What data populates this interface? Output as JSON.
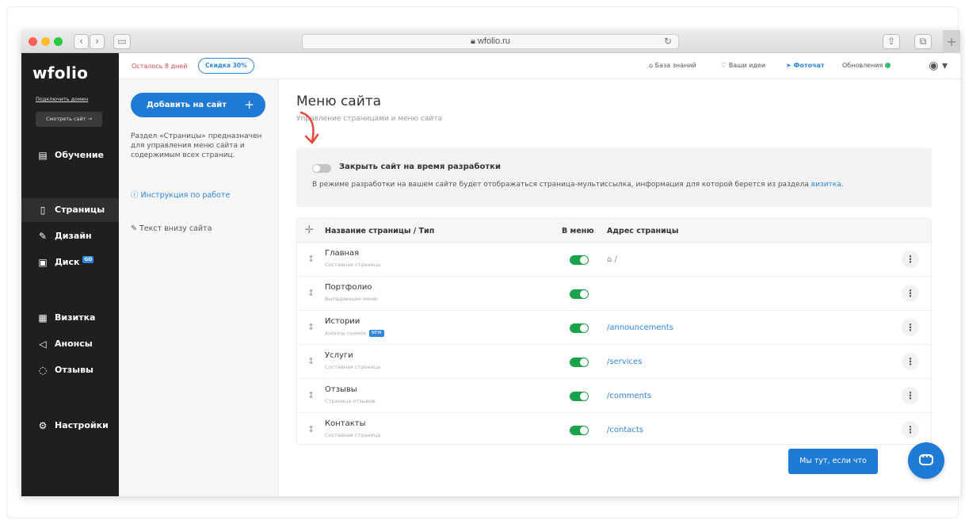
{
  "browser": {
    "url": "wfolio.ru",
    "back": "‹",
    "forward": "›",
    "plus": "+"
  },
  "sidebar": {
    "logo": "wfolio",
    "connect_domain": "Подключить домен",
    "view_site": "Смотреть сайт →",
    "items": [
      {
        "label": "Обучение",
        "icon": "book-icon"
      },
      {
        "label": "Страницы",
        "icon": "page-icon"
      },
      {
        "label": "Дизайн",
        "icon": "brush-icon"
      },
      {
        "label": "Диск",
        "icon": "disk-icon",
        "badge": "GO"
      },
      {
        "label": "Визитка",
        "icon": "card-icon"
      },
      {
        "label": "Анонсы",
        "icon": "megaphone-icon"
      },
      {
        "label": "Отзывы",
        "icon": "chat-icon"
      },
      {
        "label": "Настройки",
        "icon": "gear-icon"
      }
    ]
  },
  "topbar": {
    "days_left": "Осталось 8 дней",
    "discount": "Скидка 30%",
    "knowledge": "База знаний",
    "ideas": "Ваши идеи",
    "photochat": "Фоточат",
    "updates": "Обновления"
  },
  "panel": {
    "add_button": "Добавить на сайт",
    "add_plus": "+",
    "description": "Раздел «Страницы» предназначен для управления меню сайта и содержимым всех страниц.",
    "instruction": "Инструкция по работе",
    "footer_text": "Текст внизу сайта"
  },
  "main": {
    "title": "Меню сайта",
    "subtitle": "Управление страницами и меню сайта",
    "dev_label": "Закрыть сайт на время разработки",
    "dev_desc": "В режиме разработки на вашем сайте будет отображаться страница-мультиссылка, информация для которой берется из раздела",
    "dev_link": "визитка",
    "dev_period": ".",
    "columns": {
      "name": "Название страницы / Тип",
      "menu": "В меню",
      "address": "Адрес страницы"
    },
    "rows": [
      {
        "name": "Главная",
        "type": "Составная страница",
        "in_menu": true,
        "address": "/"
      },
      {
        "name": "Портфолио",
        "type": "Выпадающее меню",
        "in_menu": true,
        "address": ""
      },
      {
        "name": "Истории",
        "type": "Анонсы съемок",
        "badge": "NEW",
        "in_menu": true,
        "address": "/announcements"
      },
      {
        "name": "Услуги",
        "type": "Составная страница",
        "in_menu": true,
        "address": "/services"
      },
      {
        "name": "Отзывы",
        "type": "Страница отзывов",
        "in_menu": true,
        "address": "/comments"
      },
      {
        "name": "Контакты",
        "type": "Составная страница",
        "in_menu": true,
        "address": "/contacts"
      }
    ]
  },
  "chat": {
    "label": "Мы тут, если что"
  },
  "colors": {
    "accent": "#1f7ad6",
    "toggle_on": "#1aa34a",
    "sidebar": "#1f1f1f",
    "alert": "#e04b4b"
  }
}
